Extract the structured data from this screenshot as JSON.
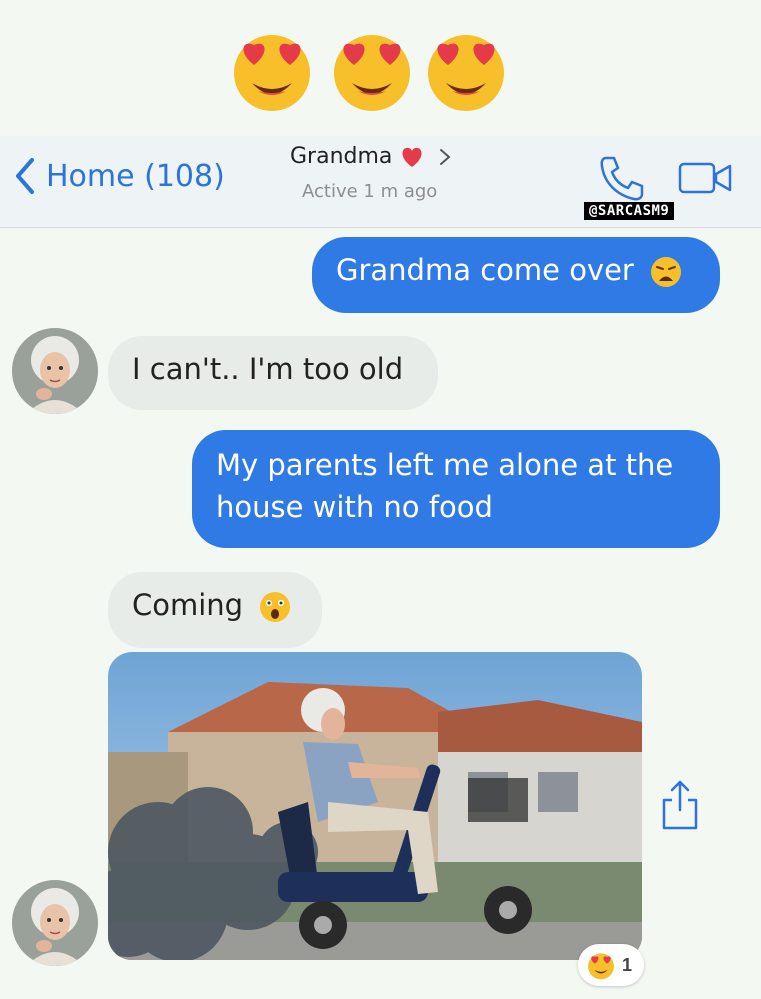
{
  "top_emojis": [
    "heart-eyes",
    "heart-eyes",
    "heart-eyes"
  ],
  "header": {
    "back_label": "Home (108)",
    "contact_name": "Grandma",
    "status": "Active 1 m ago",
    "watermark": "@SARCASM9"
  },
  "messages": [
    {
      "direction": "outgoing",
      "text": "Grandma come over",
      "emoji": "weary-face"
    },
    {
      "direction": "incoming",
      "text": "I can't.. I'm too old"
    },
    {
      "direction": "outgoing",
      "text": "My parents left me alone at the house with no food"
    },
    {
      "direction": "incoming",
      "text": "Coming",
      "emoji": "astonished-face"
    },
    {
      "direction": "incoming",
      "type": "photo",
      "content": "grandma-on-mobility-scooter"
    }
  ],
  "reaction": {
    "emoji": "heart-eyes",
    "count": "1"
  },
  "colors": {
    "accent": "#2f7ae5",
    "incoming_bubble": "#e8ece8",
    "heart": "#e43a4a"
  }
}
